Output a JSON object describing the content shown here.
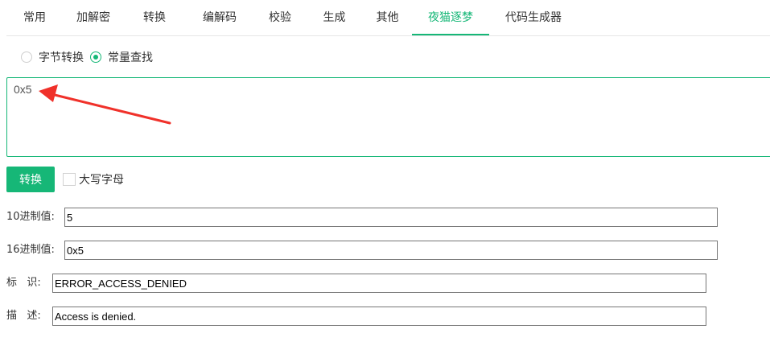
{
  "tabs": [
    {
      "label": "常用",
      "active": false
    },
    {
      "label": "加解密",
      "active": false
    },
    {
      "label": "转换",
      "active": false
    },
    {
      "label": "编解码",
      "active": false
    },
    {
      "label": "校验",
      "active": false
    },
    {
      "label": "生成",
      "active": false
    },
    {
      "label": "其他",
      "active": false
    },
    {
      "label": "夜猫逐梦",
      "active": true
    },
    {
      "label": "代码生成器",
      "active": false
    }
  ],
  "mode_options": {
    "byte_convert": {
      "label": "字节转换",
      "checked": false
    },
    "constant_lookup": {
      "label": "常量查找",
      "checked": true
    }
  },
  "input": {
    "value": "0x5"
  },
  "actions": {
    "convert_label": "转换",
    "uppercase_label": "大写字母",
    "uppercase_checked": false
  },
  "results": {
    "decimal": {
      "label": "10进制值:",
      "value": "5"
    },
    "hex": {
      "label": "16进制值:",
      "value": "0x5"
    },
    "identifier": {
      "label": "标   识:",
      "value": "ERROR_ACCESS_DENIED"
    },
    "description": {
      "label": "描   述:",
      "value": "Access is denied."
    }
  },
  "colors": {
    "accent": "#16b777",
    "annotation_arrow": "#f0312a"
  }
}
